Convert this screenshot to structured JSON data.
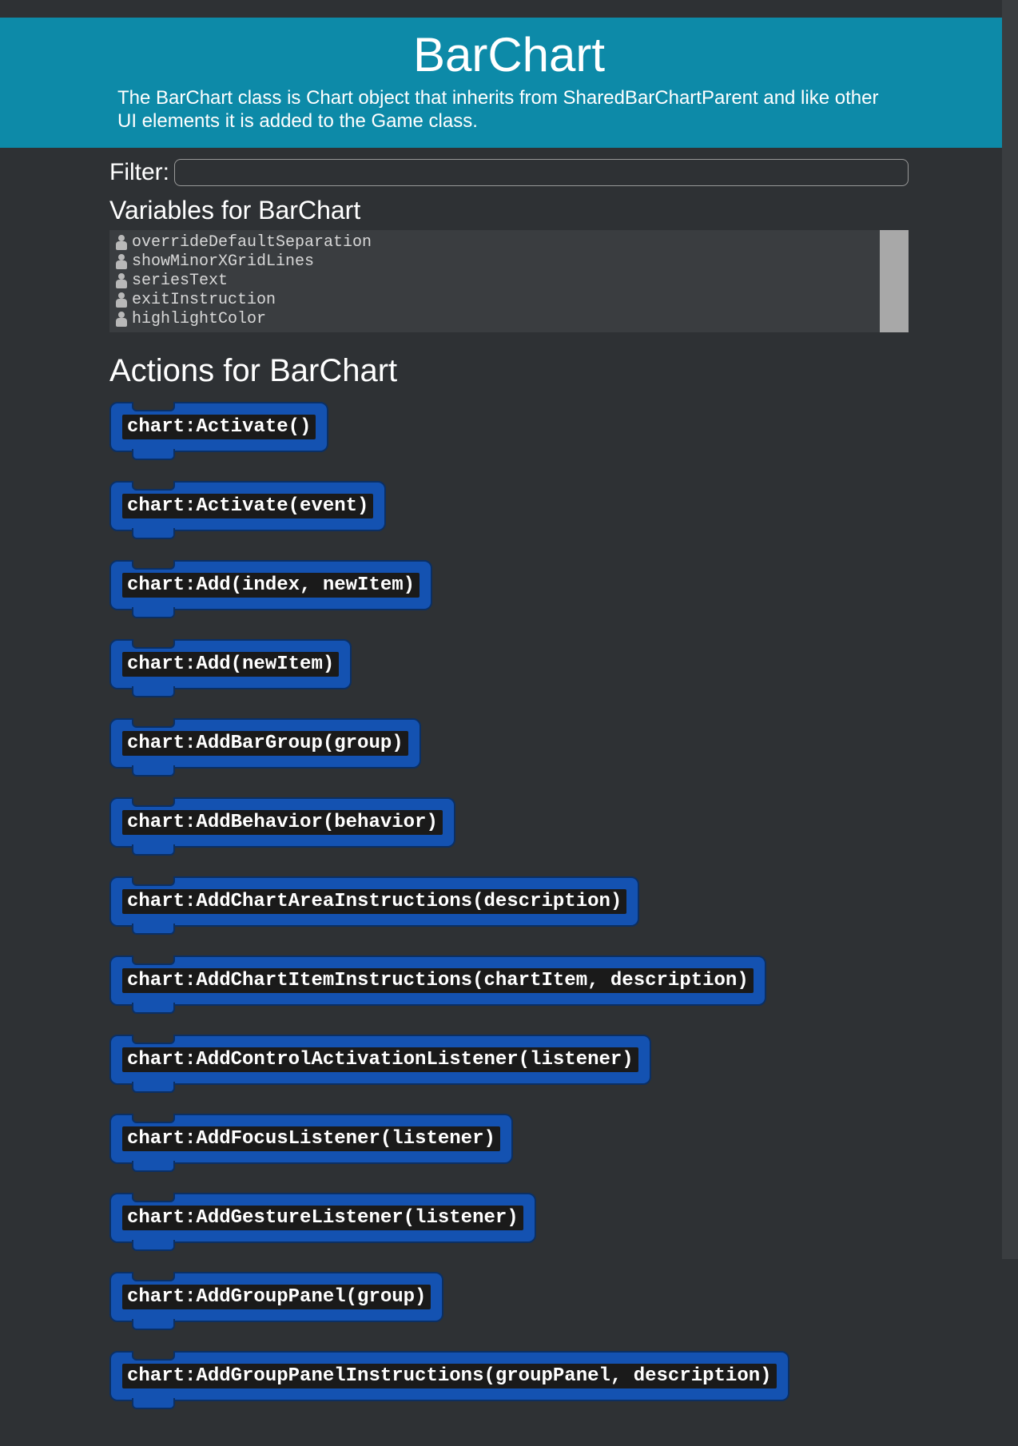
{
  "header": {
    "title": "BarChart",
    "description": "The BarChart class is Chart object that inherits from SharedBarChartParent and like other UI elements it is added to the Game class."
  },
  "filter": {
    "label": "Filter:",
    "value": ""
  },
  "variables": {
    "heading": "Variables for BarChart",
    "items": [
      "overrideDefaultSeparation",
      "showMinorXGridLines",
      "seriesText",
      "exitInstruction",
      "highlightColor"
    ]
  },
  "actions": {
    "heading": "Actions for BarChart",
    "items": [
      "chart:Activate()",
      "chart:Activate(event)",
      "chart:Add(index, newItem)",
      "chart:Add(newItem)",
      "chart:AddBarGroup(group)",
      "chart:AddBehavior(behavior)",
      "chart:AddChartAreaInstructions(description)",
      "chart:AddChartItemInstructions(chartItem, description)",
      "chart:AddControlActivationListener(listener)",
      "chart:AddFocusListener(listener)",
      "chart:AddGestureListener(listener)",
      "chart:AddGroupPanel(group)",
      "chart:AddGroupPanelInstructions(groupPanel, description)"
    ]
  }
}
